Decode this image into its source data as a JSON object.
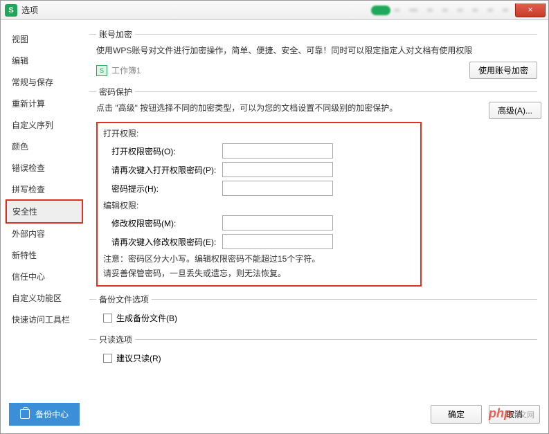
{
  "window": {
    "title": "选项",
    "close": "×"
  },
  "sidebar": {
    "items": [
      {
        "label": "视图"
      },
      {
        "label": "编辑"
      },
      {
        "label": "常规与保存"
      },
      {
        "label": "重新计算"
      },
      {
        "label": "自定义序列"
      },
      {
        "label": "颜色"
      },
      {
        "label": "错误检查"
      },
      {
        "label": "拼写检查"
      },
      {
        "label": "安全性",
        "selected": true,
        "highlighted": true
      },
      {
        "label": "外部内容"
      },
      {
        "label": "新特性"
      },
      {
        "label": "信任中心"
      },
      {
        "label": "自定义功能区"
      },
      {
        "label": "快速访问工具栏"
      }
    ]
  },
  "account_encrypt": {
    "legend": "账号加密",
    "desc": "使用WPS账号对文件进行加密操作，简单、便捷、安全、可靠！同时可以限定指定人对文档有使用权限",
    "file_name": "工作簿1",
    "button": "使用账号加密"
  },
  "password_protect": {
    "legend": "密码保护",
    "desc": "点击 \"高级\" 按钮选择不同的加密类型，可以为您的文档设置不同级别的加密保护。",
    "advanced_btn": "高级(A)...",
    "open_section": "打开权限:",
    "open_pw": "打开权限密码(O):",
    "open_pw_confirm": "请再次键入打开权限密码(P):",
    "hint": "密码提示(H):",
    "edit_section": "编辑权限:",
    "edit_pw": "修改权限密码(M):",
    "edit_pw_confirm": "请再次键入修改权限密码(E):",
    "note1": "注意：密码区分大小写。编辑权限密码不能超过15个字符。",
    "note2": "请妥善保管密码，一旦丢失或遗忘，则无法恢复。"
  },
  "backup_options": {
    "legend": "备份文件选项",
    "generate": "生成备份文件(B)"
  },
  "readonly": {
    "legend": "只读选项",
    "suggest": "建议只读(R)"
  },
  "footer": {
    "backup_center": "备份中心",
    "ok": "确定",
    "cancel": "取消"
  },
  "watermark": {
    "p": "php",
    "txt": "中文网"
  }
}
